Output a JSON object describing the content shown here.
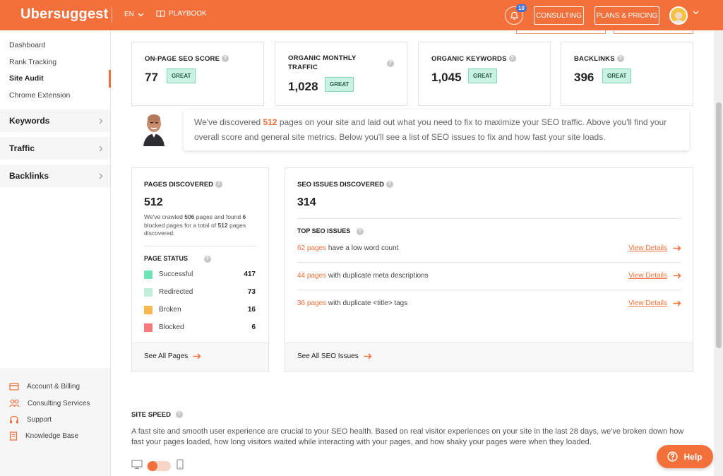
{
  "header": {
    "logo": "Ubersuggest",
    "language": "EN",
    "playbook": "PLAYBOOK",
    "notification_count": "10",
    "consulting": "CONSULTING",
    "plans_pricing": "PLANS & PRICING"
  },
  "sidebar": {
    "links": [
      "Dashboard",
      "Rank Tracking",
      "Site Audit",
      "Chrome Extension"
    ],
    "groups": [
      "Keywords",
      "Traffic",
      "Backlinks"
    ],
    "bottom": [
      "Account & Billing",
      "Consulting Services",
      "Support",
      "Knowledge Base"
    ]
  },
  "metrics": [
    {
      "title": "ON-PAGE SEO SCORE",
      "value": "77",
      "badge": "GREAT"
    },
    {
      "title": "ORGANIC MONTHLY TRAFFIC",
      "value": "1,028",
      "badge": "GREAT"
    },
    {
      "title": "ORGANIC KEYWORDS",
      "value": "1,045",
      "badge": "GREAT"
    },
    {
      "title": "BACKLINKS",
      "value": "396",
      "badge": "GREAT"
    }
  ],
  "intro": {
    "before": "We've discovered ",
    "count": "512",
    "after": " pages on your site and laid out what you need to fix to maximize your SEO traffic. Above you'll find your overall score and general site metrics. Below you'll see a list of SEO issues to fix and how fast your site loads."
  },
  "pages": {
    "title": "PAGES DISCOVERED",
    "value": "512",
    "desc_1": "We've crawled ",
    "crawled": "506",
    "desc_2": " pages and found ",
    "blocked": "6",
    "desc_3": " blocked pages for a total of ",
    "total": "512",
    "desc_4": " pages discovered.",
    "status_title": "PAGE STATUS",
    "statuses": [
      {
        "label": "Successful",
        "count": "417",
        "color": "#6fe3b8"
      },
      {
        "label": "Redirected",
        "count": "73",
        "color": "#c1efdc"
      },
      {
        "label": "Broken",
        "count": "16",
        "color": "#f9b84e"
      },
      {
        "label": "Blocked",
        "count": "6",
        "color": "#f47b7b"
      }
    ],
    "see_all": "See All Pages"
  },
  "issues": {
    "title": "SEO ISSUES DISCOVERED",
    "value": "314",
    "top_title": "TOP SEO ISSUES",
    "rows": [
      {
        "pages": "62 pages",
        "text": " have a low word count",
        "link": "View Details"
      },
      {
        "pages": "44 pages",
        "text": " with duplicate meta descriptions",
        "link": "View Details"
      },
      {
        "pages": "36 pages",
        "text": " with duplicate <title> tags",
        "link": "View Details"
      }
    ],
    "see_all": "See All SEO Issues"
  },
  "site_speed": {
    "title": "SITE SPEED",
    "text": "A fast site and smooth user experience are crucial to your SEO health. Based on real visitor experiences on your site in the last 28 days, we've broken down how fast your pages loaded, how long visitors waited while interacting with your pages, and how shaky your pages were when they loaded."
  },
  "help_button": "Help",
  "colors": {
    "accent": "#f4703a",
    "great_bg": "#c9f2e3"
  }
}
